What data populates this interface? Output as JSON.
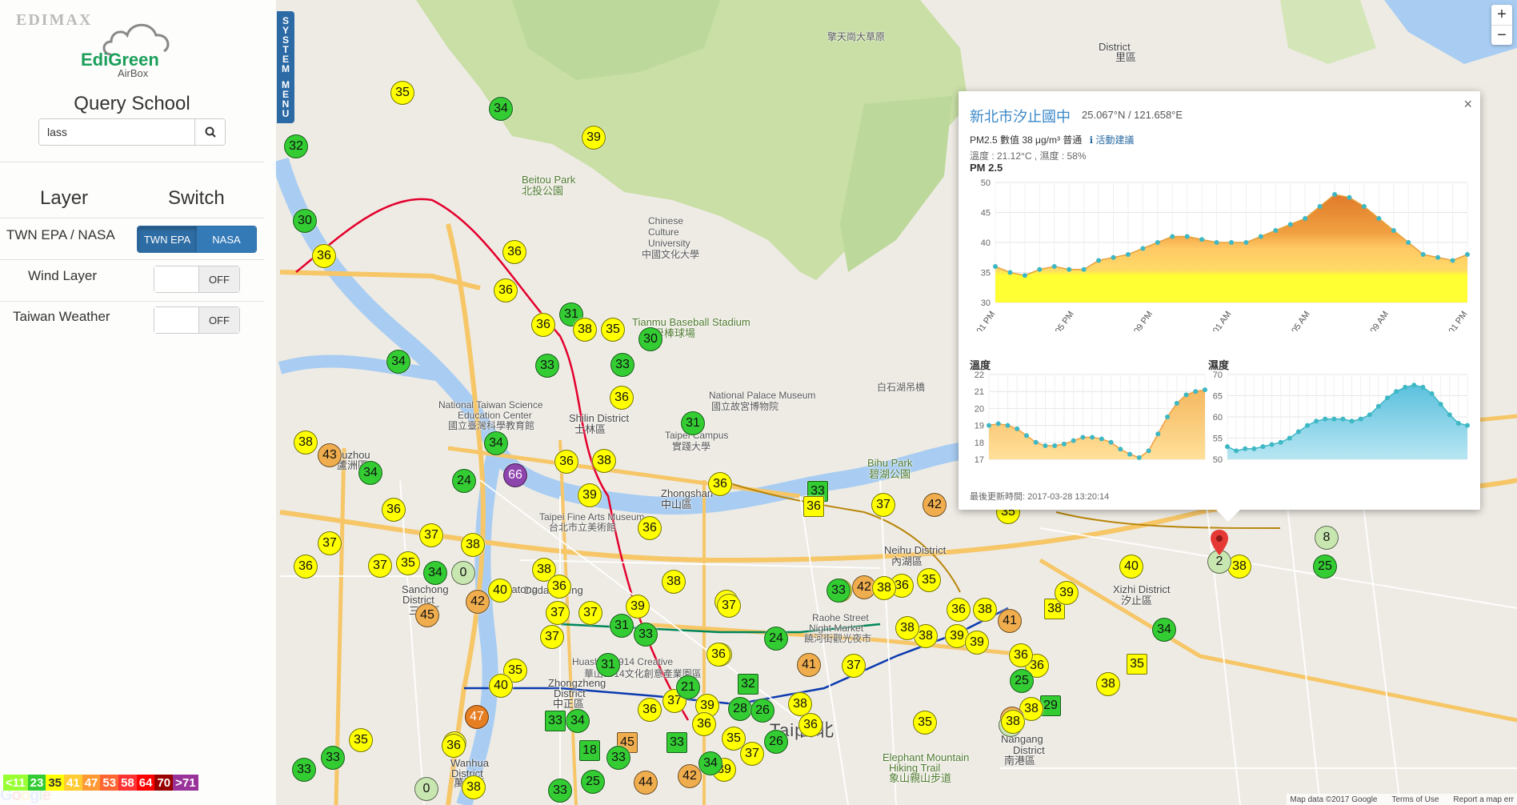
{
  "panel": {
    "edimax": "EDIMAX",
    "logo_main": "EdiGreen",
    "logo_sub": "AirBox",
    "query_title": "Query School",
    "search_value": "lass",
    "layer_header": "Layer",
    "switch_header": "Switch",
    "rows": {
      "source_label": "TWN EPA / NASA",
      "wind_label": "Wind Layer",
      "weather_label": "Taiwan Weather"
    },
    "source_options": [
      "TWN EPA",
      "NASA"
    ],
    "wind_state": "OFF",
    "weather_state": "OFF"
  },
  "system_menu": [
    "S",
    "Y",
    "S",
    "T",
    "E",
    "M",
    "",
    "M",
    "E",
    "N",
    "U"
  ],
  "legend": [
    {
      "label": "<11",
      "color": "#99ff33"
    },
    {
      "label": "23",
      "color": "#33cc33"
    },
    {
      "label": "35",
      "color": "#ffff00"
    },
    {
      "label": "41",
      "color": "#ffcc33"
    },
    {
      "label": "47",
      "color": "#ff9933"
    },
    {
      "label": "53",
      "color": "#ff6633"
    },
    {
      "label": "58",
      "color": "#ff3333"
    },
    {
      "label": "64",
      "color": "#ff0000"
    },
    {
      "label": "70",
      "color": "#990000"
    },
    {
      "label": ">71",
      "color": "#993399"
    }
  ],
  "map": {
    "attribution": [
      "Map data ©2017 Google",
      "Terms of Use",
      "Report a map err"
    ],
    "google": "Google",
    "labels": [
      {
        "t": "Beitou Park",
        "cls": "poi"
      },
      {
        "t": "北投公園",
        "cls": "poi"
      },
      {
        "t": "Chinese",
        "cls": ""
      },
      {
        "t": "Culture",
        "cls": ""
      },
      {
        "t": "University",
        "cls": ""
      },
      {
        "t": "中國文化大學",
        "cls": ""
      },
      {
        "t": "Tianmu Baseball Stadium",
        "cls": "poi"
      },
      {
        "t": "天母棒球場",
        "cls": "poi"
      },
      {
        "t": "National Palace Museum",
        "cls": ""
      },
      {
        "t": "國立故宮博物院",
        "cls": ""
      },
      {
        "t": "National Taiwan Science",
        "cls": ""
      },
      {
        "t": "Education Center",
        "cls": ""
      },
      {
        "t": "國立臺灣科學教育館",
        "cls": ""
      },
      {
        "t": "Shilin District",
        "cls": "dist"
      },
      {
        "t": "士林區",
        "cls": "dist"
      },
      {
        "t": "Taipei Campus",
        "cls": ""
      },
      {
        "t": "實踐大學",
        "cls": ""
      },
      {
        "t": "Zhongshan",
        "cls": "dist"
      },
      {
        "t": "中山區",
        "cls": "dist"
      },
      {
        "t": "Taipei Fine Arts Museum",
        "cls": ""
      },
      {
        "t": "台北市立美術館",
        "cls": ""
      },
      {
        "t": "Bihu Park",
        "cls": "poi"
      },
      {
        "t": "碧湖公園",
        "cls": "poi"
      },
      {
        "t": "Neihu District",
        "cls": "dist"
      },
      {
        "t": "內湖區",
        "cls": "dist"
      },
      {
        "t": "Xizhi District",
        "cls": "dist"
      },
      {
        "t": "汐止區",
        "cls": "dist"
      },
      {
        "t": "Raohe Street",
        "cls": ""
      },
      {
        "t": "Night Market",
        "cls": ""
      },
      {
        "t": "饒河街觀光夜市",
        "cls": ""
      },
      {
        "t": "Sanchong",
        "cls": "dist"
      },
      {
        "t": "District",
        "cls": "dist"
      },
      {
        "t": "三重區",
        "cls": "dist"
      },
      {
        "t": "Luzhou",
        "cls": "dist"
      },
      {
        "t": "蘆洲區",
        "cls": "dist"
      },
      {
        "t": "Taipei",
        "cls": "big"
      },
      {
        "t": "台北",
        "cls": "big"
      },
      {
        "t": "Nangang",
        "cls": "dist"
      },
      {
        "t": "District",
        "cls": "dist"
      },
      {
        "t": "南港區",
        "cls": "dist"
      },
      {
        "t": "Elephant Mountain",
        "cls": "poi"
      },
      {
        "t": "Hiking Trail",
        "cls": "poi"
      },
      {
        "t": "象山親山步道",
        "cls": "poi"
      },
      {
        "t": "Wanhua",
        "cls": "dist"
      },
      {
        "t": "District",
        "cls": "dist"
      },
      {
        "t": "萬華區",
        "cls": "dist"
      },
      {
        "t": "Zhongzheng",
        "cls": "dist"
      },
      {
        "t": "District",
        "cls": "dist"
      },
      {
        "t": "中正區",
        "cls": "dist"
      },
      {
        "t": "Dadaocheng",
        "cls": "dist"
      },
      {
        "t": "Huashan 1914 Creative",
        "cls": ""
      },
      {
        "t": "華山1914文化創意產業園區",
        "cls": ""
      },
      {
        "t": "Datong",
        "cls": "dist"
      },
      {
        "t": "District",
        "cls": "dist"
      },
      {
        "t": "里區",
        "cls": "dist"
      },
      {
        "t": "擎天崗大草原",
        "cls": ""
      },
      {
        "t": "白石湖吊橋",
        "cls": ""
      }
    ],
    "markers": [
      {
        "v": "35",
        "c": "#ffff00"
      },
      {
        "v": "34",
        "c": "#33cc33"
      },
      {
        "v": "39",
        "c": "#ffff00"
      },
      {
        "v": "32",
        "c": "#33cc33"
      },
      {
        "v": "30",
        "c": "#33cc33"
      },
      {
        "v": "36",
        "c": "#ffff00"
      },
      {
        "v": "36",
        "c": "#ffff00"
      },
      {
        "v": "36",
        "c": "#ffff00"
      },
      {
        "v": "31",
        "c": "#33cc33"
      },
      {
        "v": "36",
        "c": "#ffff00"
      },
      {
        "v": "38",
        "c": "#ffff00"
      },
      {
        "v": "35",
        "c": "#ffff00"
      },
      {
        "v": "30",
        "c": "#33cc33"
      },
      {
        "v": "33",
        "c": "#33cc33"
      },
      {
        "v": "33",
        "c": "#33cc33"
      },
      {
        "v": "34",
        "c": "#33cc33"
      },
      {
        "v": "36",
        "c": "#ffff00"
      },
      {
        "v": "31",
        "c": "#33cc33"
      },
      {
        "v": "34",
        "c": "#33cc33"
      },
      {
        "v": "66",
        "c": "#8e44ad"
      },
      {
        "v": "24",
        "c": "#33cc33"
      },
      {
        "v": "36",
        "c": "#ffff00"
      },
      {
        "v": "38",
        "c": "#ffff00"
      },
      {
        "v": "39",
        "c": "#ffff00"
      },
      {
        "v": "36",
        "c": "#ffff00"
      },
      {
        "v": "36",
        "c": "#ffff00"
      },
      {
        "v": "33",
        "c": "#33cc33"
      },
      {
        "v": "37",
        "c": "#ffff00"
      },
      {
        "v": "42",
        "c": "#f0ad4e"
      },
      {
        "v": "38",
        "c": "#ffff00"
      },
      {
        "v": "43",
        "c": "#f0ad4e"
      },
      {
        "v": "35",
        "c": "#ffff00"
      },
      {
        "v": "34",
        "c": "#33cc33"
      },
      {
        "v": "36",
        "c": "#ffff00"
      },
      {
        "v": "37",
        "c": "#ffff00"
      },
      {
        "v": "37",
        "c": "#ffff00"
      },
      {
        "v": "37",
        "c": "#ffff00"
      },
      {
        "v": "35",
        "c": "#ffff00"
      },
      {
        "v": "34",
        "c": "#33cc33"
      },
      {
        "v": "0",
        "c": "#c8e6b0"
      },
      {
        "v": "38",
        "c": "#ffff00"
      },
      {
        "v": "36",
        "c": "#ffff00"
      },
      {
        "v": "45",
        "c": "#f0ad4e"
      },
      {
        "v": "42",
        "c": "#f0ad4e"
      },
      {
        "v": "40",
        "c": "#ffff00"
      },
      {
        "v": "38",
        "c": "#ffff00"
      },
      {
        "v": "36",
        "c": "#ffff00"
      },
      {
        "v": "37",
        "c": "#ffff00"
      },
      {
        "v": "37",
        "c": "#ffff00"
      },
      {
        "v": "37",
        "c": "#ffff00"
      },
      {
        "v": "38",
        "c": "#ffff00"
      },
      {
        "v": "39",
        "c": "#ffff00"
      },
      {
        "v": "31",
        "c": "#33cc33"
      },
      {
        "v": "33",
        "c": "#33cc33"
      },
      {
        "v": "39",
        "c": "#ffff00"
      },
      {
        "v": "36",
        "c": "#ffff00"
      },
      {
        "v": "37",
        "c": "#ffff00"
      },
      {
        "v": "24",
        "c": "#33cc33"
      },
      {
        "v": "31",
        "c": "#33cc33"
      },
      {
        "v": "36",
        "c": "#ffff00"
      },
      {
        "v": "35",
        "c": "#ffff00"
      },
      {
        "v": "40",
        "c": "#ffff00"
      },
      {
        "v": "37",
        "c": "#ffff00"
      },
      {
        "v": "21",
        "c": "#33cc33"
      },
      {
        "v": "32",
        "c": "#33cc33"
      },
      {
        "v": "36",
        "c": "#ffff00"
      },
      {
        "v": "39",
        "c": "#ffff00"
      },
      {
        "v": "28",
        "c": "#33cc33"
      },
      {
        "v": "26",
        "c": "#33cc33"
      },
      {
        "v": "38",
        "c": "#ffff00"
      },
      {
        "v": "41",
        "c": "#f0ad4e"
      },
      {
        "v": "36",
        "c": "#ffff00"
      },
      {
        "v": "47",
        "c": "#e67e22"
      },
      {
        "v": "33",
        "c": "#33cc33"
      },
      {
        "v": "34",
        "c": "#33cc33"
      },
      {
        "v": "36",
        "c": "#ffff00"
      },
      {
        "v": "35",
        "c": "#ffff00"
      },
      {
        "v": "33",
        "c": "#33cc33"
      },
      {
        "v": "45",
        "c": "#f0ad4e"
      },
      {
        "v": "33",
        "c": "#33cc33"
      },
      {
        "v": "18",
        "c": "#33cc33"
      },
      {
        "v": "33",
        "c": "#33cc33"
      },
      {
        "v": "39",
        "c": "#ffff00"
      },
      {
        "v": "26",
        "c": "#33cc33"
      },
      {
        "v": "37",
        "c": "#ffff00"
      },
      {
        "v": "34",
        "c": "#33cc33"
      },
      {
        "v": "44",
        "c": "#f0ad4e"
      },
      {
        "v": "42",
        "c": "#f0ad4e"
      },
      {
        "v": "25",
        "c": "#33cc33"
      },
      {
        "v": "38",
        "c": "#ffff00"
      },
      {
        "v": "39",
        "c": "#ffff00"
      },
      {
        "v": "35",
        "c": "#ffff00"
      },
      {
        "v": "33",
        "c": "#33cc33"
      },
      {
        "v": "36",
        "c": "#ffff00"
      },
      {
        "v": "0",
        "c": "#c8e6b0"
      },
      {
        "v": "33",
        "c": "#33cc33"
      },
      {
        "v": "37",
        "c": "#ffff00"
      },
      {
        "v": "42",
        "c": "#f0ad4e"
      },
      {
        "v": "36",
        "c": "#ffff00"
      },
      {
        "v": "36",
        "c": "#ffff00"
      },
      {
        "v": "35",
        "c": "#ffff00"
      },
      {
        "v": "36",
        "c": "#ffff00"
      },
      {
        "v": "39",
        "c": "#ffff00"
      },
      {
        "v": "38",
        "c": "#ffff00"
      },
      {
        "v": "39",
        "c": "#ffff00"
      },
      {
        "v": "38",
        "c": "#ffff00"
      },
      {
        "v": "37",
        "c": "#ffff00"
      },
      {
        "v": "35",
        "c": "#ffff00"
      },
      {
        "v": "5",
        "c": "#c8e6b0"
      },
      {
        "v": "38",
        "c": "#ffff00"
      },
      {
        "v": "36",
        "c": "#ffff00"
      },
      {
        "v": "36",
        "c": "#ffff00"
      },
      {
        "v": "38",
        "c": "#ffff00"
      },
      {
        "v": "38",
        "c": "#ffff00"
      },
      {
        "v": "35",
        "c": "#ffff00"
      },
      {
        "v": "34",
        "c": "#33cc33"
      },
      {
        "v": "41",
        "c": "#f0ad4e"
      },
      {
        "v": "29",
        "c": "#33cc33"
      },
      {
        "v": "38",
        "c": "#ffff00"
      },
      {
        "v": "45",
        "c": "#f0ad4e"
      },
      {
        "v": "38",
        "c": "#ffff00"
      },
      {
        "v": "25",
        "c": "#33cc33"
      },
      {
        "v": "8",
        "c": "#c8e6b0"
      },
      {
        "v": "25",
        "c": "#33cc33"
      },
      {
        "v": "38",
        "c": "#ffff00"
      },
      {
        "v": "40",
        "c": "#ffff00"
      },
      {
        "v": "2",
        "c": "#c8e6b0"
      },
      {
        "v": "39",
        "c": "#ffff00"
      },
      {
        "v": "35",
        "c": "#ffff00"
      },
      {
        "v": "33",
        "c": "#33cc33"
      },
      {
        "v": "38",
        "c": "#ffff00"
      }
    ]
  },
  "popup": {
    "title": "新北市汐止國中",
    "coords": "25.067°N / 121.658°E",
    "pm_line": "PM2.5 數值 38 μg/m³  普通",
    "tip_text": "活動建議",
    "weather_line": "溫度 : 21.12°C , 濕度 : 58%",
    "pm_chart_title": "PM 2.5",
    "temp_chart_title": "溫度",
    "hum_chart_title": "濕度",
    "updated": "最後更新時間: 2017-03-28 13:20:14"
  },
  "chart_data": [
    {
      "type": "area",
      "title": "PM 2.5",
      "x": [
        "01 PM",
        "02 PM",
        "03 PM",
        "04 PM",
        "05 PM",
        "06 PM",
        "07 PM",
        "08 PM",
        "09 PM",
        "10 PM",
        "11 PM",
        "12 AM",
        "01 AM",
        "02 AM",
        "03 AM",
        "04 AM",
        "05 AM",
        "06 AM",
        "07 AM",
        "08 AM",
        "09 AM",
        "10 AM",
        "11 AM",
        "12 PM",
        "01 PM"
      ],
      "x_tick_labels": [
        "01 PM",
        "05 PM",
        "09 PM",
        "01 AM",
        "05 AM",
        "09 AM",
        "01 PM"
      ],
      "values": [
        36,
        35,
        34.5,
        35.5,
        36,
        35.5,
        35.5,
        37,
        37.5,
        38,
        39,
        40,
        41,
        41,
        40.5,
        40,
        40,
        40,
        41,
        42,
        43,
        44,
        46,
        48,
        47.5,
        46,
        44,
        42,
        40,
        38,
        37.5,
        37,
        38
      ],
      "ylim": [
        30,
        50
      ],
      "yticks": [
        30,
        35,
        40,
        45,
        50
      ],
      "grid": true,
      "color_bands": [
        "#ffff33",
        "#ffcc66",
        "#e67e22"
      ]
    },
    {
      "type": "area",
      "title": "溫度",
      "values": [
        19,
        19.1,
        19,
        18.8,
        18.4,
        18,
        17.8,
        17.8,
        17.9,
        18.1,
        18.3,
        18.3,
        18.2,
        18,
        17.6,
        17.3,
        17.1,
        17.5,
        18.5,
        19.5,
        20.3,
        20.8,
        21,
        21.1
      ],
      "ylim": [
        17,
        22
      ],
      "yticks": [
        17,
        18,
        19,
        20,
        21,
        22
      ],
      "grid": true
    },
    {
      "type": "area",
      "title": "濕度",
      "values": [
        53,
        52,
        52.5,
        52.5,
        53,
        53.5,
        54,
        55,
        56.5,
        58,
        59,
        59.5,
        59.5,
        59.5,
        59,
        59.5,
        60.5,
        62.5,
        64.5,
        66,
        67,
        67.5,
        67,
        65.5,
        63,
        60.5,
        58.5,
        58
      ],
      "ylim": [
        50,
        70
      ],
      "yticks": [
        50,
        55,
        60,
        65,
        70
      ],
      "grid": true
    }
  ]
}
